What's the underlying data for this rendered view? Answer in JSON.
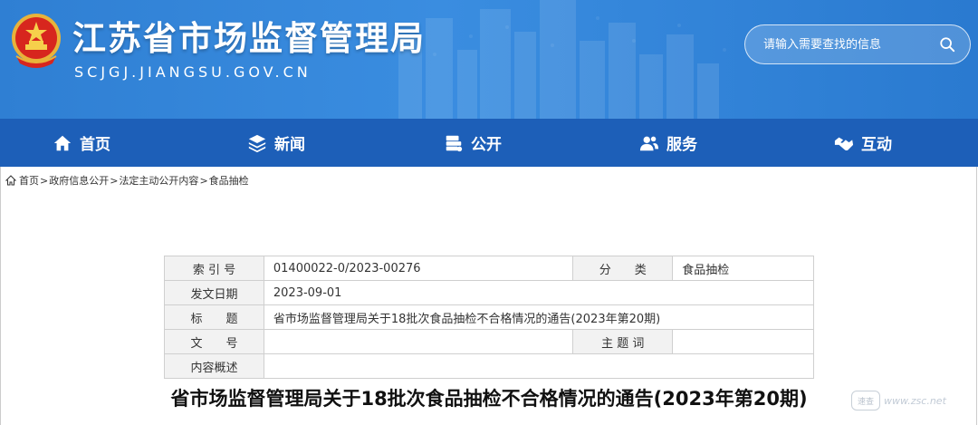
{
  "header": {
    "site_title": "江苏省市场监督管理局",
    "site_domain": "SCJGJ.JIANGSU.GOV.CN",
    "search_placeholder": "请输入需要查找的信息",
    "bg_color": "#3a8de0"
  },
  "nav": {
    "items": [
      {
        "label": "首页",
        "icon": "home-icon"
      },
      {
        "label": "新闻",
        "icon": "layers-icon"
      },
      {
        "label": "公开",
        "icon": "document-stack-icon"
      },
      {
        "label": "服务",
        "icon": "users-icon"
      },
      {
        "label": "互动",
        "icon": "handshake-icon"
      }
    ],
    "bg_color": "#1d5fb8"
  },
  "breadcrumb": {
    "items": [
      "首页",
      "政府信息公开",
      "法定主动公开内容",
      "食品抽检"
    ],
    "separator": ">"
  },
  "info_table": {
    "index_label": "索 引 号",
    "index_value": "01400022-0/2023-00276",
    "category_label": "分　　类",
    "category_value": "食品抽检",
    "date_label": "发文日期",
    "date_value": "2023-09-01",
    "title_label": "标　　题",
    "title_value": "省市场监督管理局关于18批次食品抽检不合格情况的通告(2023年第20期)",
    "doc_no_label": "文　　号",
    "doc_no_value": "",
    "subject_label": "主 题 词",
    "subject_value": "",
    "summary_label": "内容概述",
    "summary_value": ""
  },
  "article": {
    "title": "省市场监督管理局关于18批次食品抽检不合格情况的通告(2023年第20期)"
  },
  "watermark": {
    "badge": "速查",
    "text": "www.zsc.net"
  }
}
